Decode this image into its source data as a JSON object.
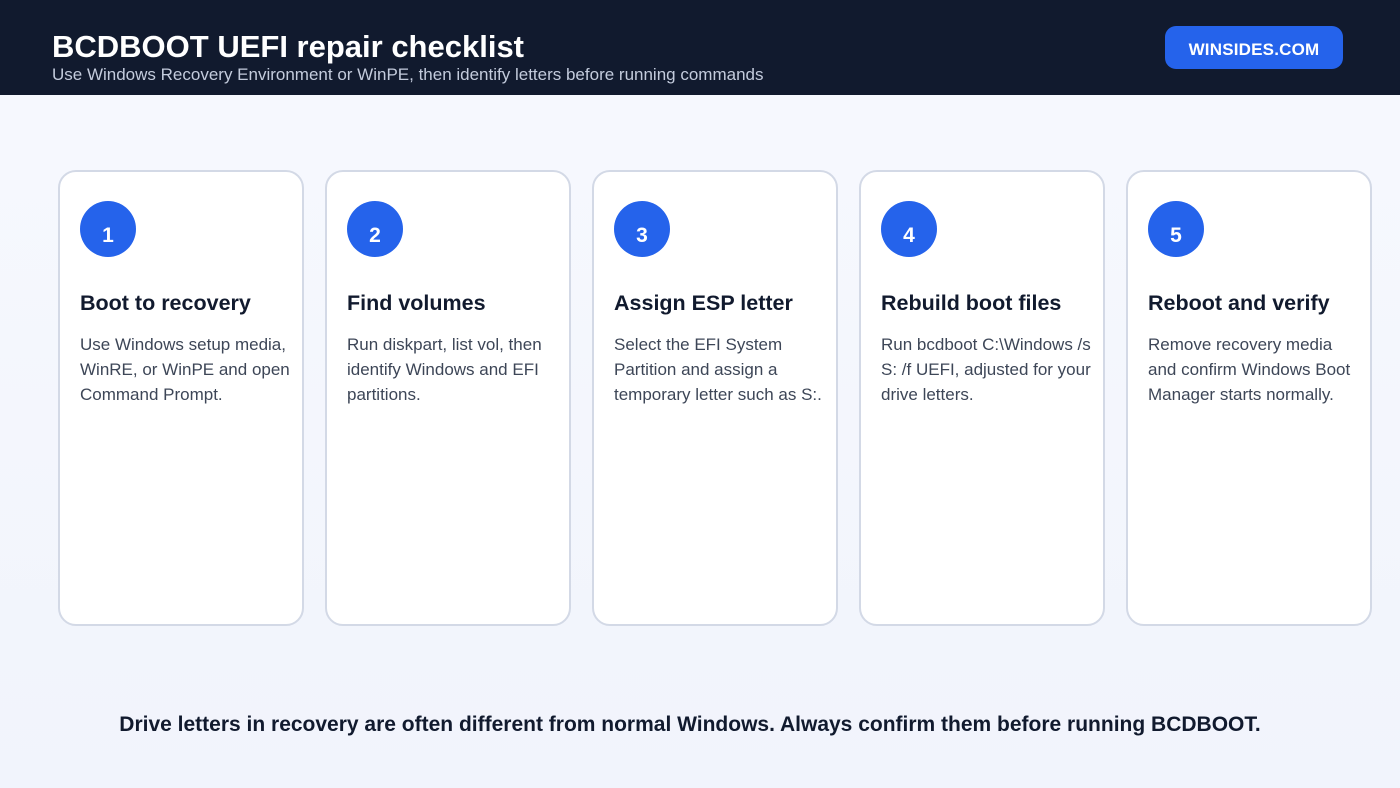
{
  "header": {
    "title": "BCDBOOT UEFI repair checklist",
    "subtitle": "Use Windows Recovery Environment or WinPE, then identify letters before running commands",
    "brand": "WINSIDES.COM"
  },
  "colors": {
    "header_bg": "#111a2e",
    "accent": "#2563eb",
    "card_border": "#d3d9e6"
  },
  "steps": [
    {
      "number": "1",
      "title": "Boot to recovery",
      "body": "Use Windows setup media, WinRE, or WinPE and open Command Prompt."
    },
    {
      "number": "2",
      "title": "Find volumes",
      "body": "Run diskpart, list vol, then identify Windows and EFI partitions."
    },
    {
      "number": "3",
      "title": "Assign ESP letter",
      "body": "Select the EFI System Partition and assign a temporary letter such as S:."
    },
    {
      "number": "4",
      "title": "Rebuild boot files",
      "body": "Run bcdboot C:\\Windows /s S: /f UEFI, adjusted for your drive letters."
    },
    {
      "number": "5",
      "title": "Reboot and verify",
      "body": "Remove recovery media and confirm Windows Boot Manager starts normally."
    }
  ],
  "footer": {
    "note": "Drive letters in recovery are often different from normal Windows. Always confirm them before running BCDBOOT."
  }
}
